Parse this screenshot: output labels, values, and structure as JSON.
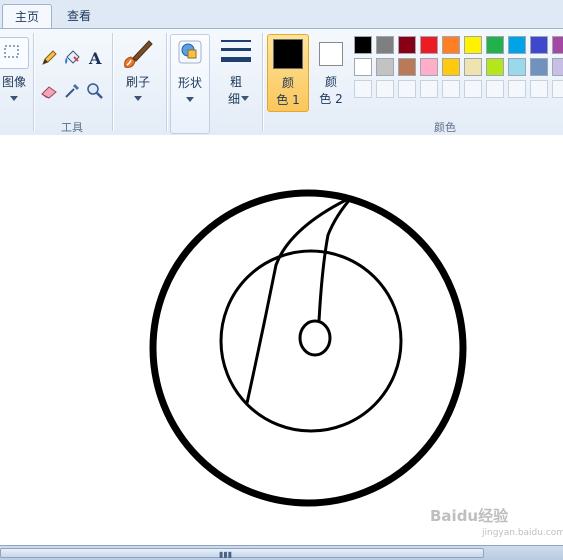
{
  "tabs": [
    {
      "label": "主页",
      "active": true
    },
    {
      "label": "查看",
      "active": false
    }
  ],
  "ribbon": {
    "image_group": {
      "label": "图像"
    },
    "tools_group": {
      "label": "工具"
    },
    "brush": {
      "label": "刷子"
    },
    "shapes": {
      "label": "形状"
    },
    "size": {
      "label_line1": "粗",
      "label_line2": "细"
    },
    "color1": {
      "label_line1": "颜",
      "label_line2": "色 1",
      "value": "#000000"
    },
    "color2": {
      "label_line1": "颜",
      "label_line2": "色 2",
      "value": "#ffffff"
    },
    "colors_group": {
      "label": "颜色"
    }
  },
  "palette": {
    "row1": [
      "#000000",
      "#7f7f7f",
      "#880015",
      "#ed1c24",
      "#ff7f27",
      "#fff200",
      "#22b14c",
      "#00a2e8",
      "#3f48cc",
      "#a349a4"
    ],
    "row2": [
      "#ffffff",
      "#c3c3c3",
      "#b97a57",
      "#ffaec9",
      "#ffc90e",
      "#efe4b0",
      "#b5e61d",
      "#99d9ea",
      "#7092be",
      "#c8bfe7"
    ],
    "row3": [
      "",
      "",
      "",
      "",
      "",
      "",
      "",
      "",
      "",
      ""
    ]
  },
  "watermark": {
    "text": "Baidu经验",
    "sub": "jingyan.baidu.com"
  }
}
